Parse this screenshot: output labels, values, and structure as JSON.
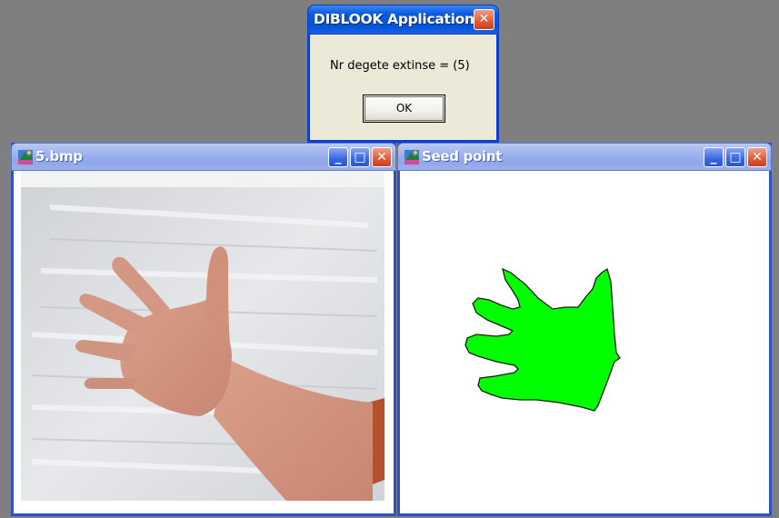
{
  "dialog": {
    "title": "DIBLOOK Application",
    "message": "Nr degete extinse = (5)",
    "ok_label": "OK",
    "close_glyph": "✕"
  },
  "windows": [
    {
      "title": "5.bmp",
      "icon": "app-image-icon",
      "minimize_glyph": "_",
      "maximize_glyph": "□",
      "close_glyph": "✕"
    },
    {
      "title": "Seed point",
      "icon": "app-image-icon",
      "minimize_glyph": "_",
      "maximize_glyph": "□",
      "close_glyph": "✕"
    }
  ],
  "colors": {
    "desktop": "#7f7f7f",
    "inactive_title": "#9fb4ee",
    "active_title": "#0552d6",
    "segmentation": "#00ff00"
  }
}
